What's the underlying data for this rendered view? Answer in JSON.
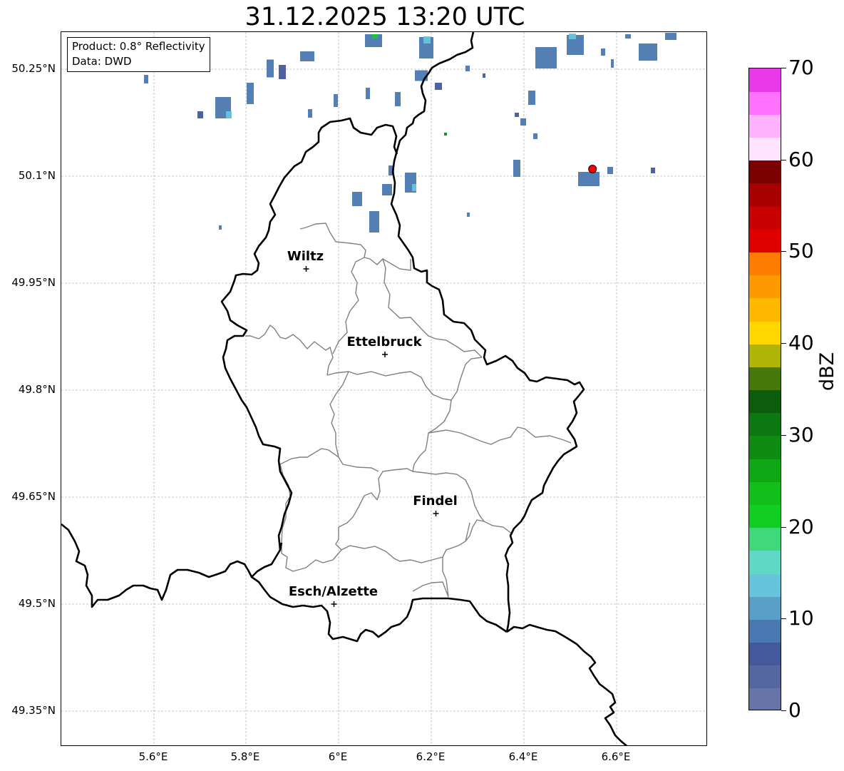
{
  "title": "31.12.2025 13:20 UTC",
  "info_box": {
    "product": "Product: 0.8° Reflectivity",
    "data": "Data: DWD"
  },
  "axes": {
    "lat_labels": [
      "50.25°N",
      "50.1°N",
      "49.95°N",
      "49.8°N",
      "49.65°N",
      "49.5°N",
      "49.35°N"
    ],
    "lon_labels": [
      "5.6°E",
      "5.8°E",
      "6°E",
      "6.2°E",
      "6.4°E",
      "6.6°E"
    ],
    "gridlines": true
  },
  "cities": [
    {
      "name": "Wiltz",
      "lon": 5.93,
      "lat": 49.97
    },
    {
      "name": "Ettelbruck",
      "lon": 6.1,
      "lat": 49.85
    },
    {
      "name": "Findel",
      "lon": 6.21,
      "lat": 49.627
    },
    {
      "name": "Esch/Alzette",
      "lon": 5.99,
      "lat": 49.5
    }
  ],
  "radar_marker": {
    "lon": 6.548,
    "lat": 50.11,
    "color": "#ff0000"
  },
  "colorbar": {
    "label": "dBZ",
    "min": 0,
    "max": 70,
    "tick_labels": [
      "0",
      "10",
      "20",
      "30",
      "40",
      "50",
      "60",
      "70"
    ],
    "colors": [
      "#6674a8",
      "#5567a0",
      "#44599c",
      "#4a78b0",
      "#58a0c8",
      "#66c4dc",
      "#5fd8c6",
      "#3fd87a",
      "#11ce22",
      "#11be1a",
      "#10a714",
      "#0e8c11",
      "#0c7812",
      "#0b5d0b",
      "#47780a",
      "#b1b408",
      "#ffd700",
      "#ffb800",
      "#ff9900",
      "#ff7c00",
      "#e10000",
      "#c70000",
      "#a80000",
      "#7c0000",
      "#ffe3ff",
      "#ffb3ff",
      "#ff72ff",
      "#e83ae8"
    ]
  }
}
